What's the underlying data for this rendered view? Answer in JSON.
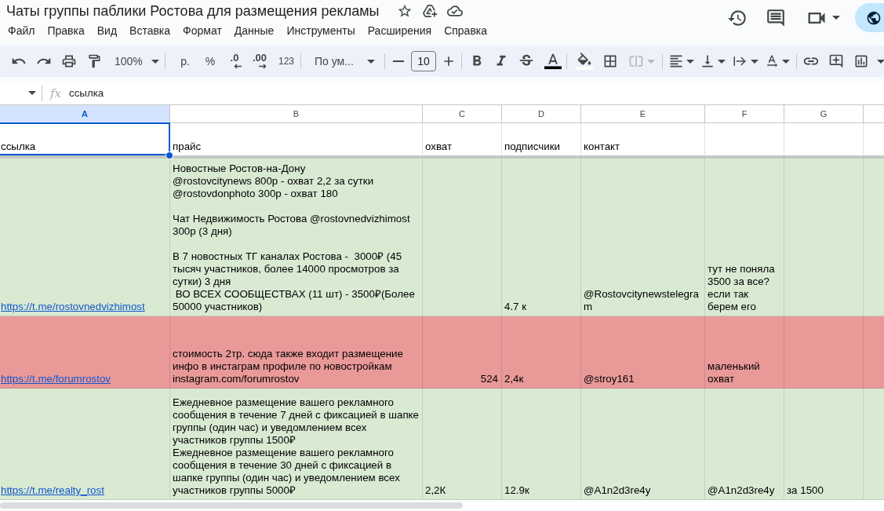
{
  "document": {
    "title": "Чаты группы паблики Ростова для размещения рекламы"
  },
  "menu": [
    "Файл",
    "Правка",
    "Вид",
    "Вставка",
    "Формат",
    "Данные",
    "Инструменты",
    "Расширения",
    "Справка"
  ],
  "toolbar": {
    "zoom": "100%",
    "currency": "р.",
    "percent": "%",
    "decimal_decrease": ".0",
    "decimal_increase": ".00",
    "number_format": "123",
    "font": "По ум...",
    "font_size": "10",
    "merge": {
      "disabled": true
    }
  },
  "formula_bar": {
    "function_label": "fx",
    "formula": "ссылка"
  },
  "columns": [
    {
      "letter": "A",
      "selected": true
    },
    {
      "letter": "B",
      "selected": false
    },
    {
      "letter": "C",
      "selected": false
    },
    {
      "letter": "D",
      "selected": false
    },
    {
      "letter": "E",
      "selected": false
    },
    {
      "letter": "F",
      "selected": false
    },
    {
      "letter": "G",
      "selected": false
    },
    {
      "selected": false
    }
  ],
  "rows": [
    {
      "selected": true,
      "cells": [
        {
          "text": "ссылка",
          "kind": "text"
        },
        {
          "text": "прайс",
          "kind": "text"
        },
        {
          "text": "охват",
          "kind": "text"
        },
        {
          "text": "подписчики",
          "kind": "text"
        },
        {
          "text": "контакт",
          "kind": "text"
        }
      ]
    },
    {
      "selected": false,
      "color": "#d9ead3",
      "cells": [
        {
          "text": "https://t.me/rostovnedvizhimost",
          "kind": "link"
        },
        {
          "text": "Новостные Ростов-на-Дону\n@rostovcitynews 800р - охват 2,2 за сутки\n@rostovdonphoto 300р - охват 180\n\nЧат Недвижимость Ростова @rostovnedvizhimost\n300р (3 дня)\n\nВ 7 новостных ТГ каналах Ростова -  3000₽ (45\nтысяч участников, более 14000 просмотров за\nсутки) 3 дня\n ВО ВСЕХ СООБЩЕСТВАХ (11 шт) - 3500₽(Более\n50000 участников)",
          "kind": "text"
        },
        null,
        {
          "text": "4.7 к",
          "kind": "text"
        },
        {
          "text": "@Rostovcitynewstelegram",
          "kind": "text"
        },
        {
          "text": "тут не поняла\n3500 за все?\nесли так\nберем его",
          "kind": "text"
        }
      ]
    },
    {
      "selected": false,
      "color": "#ea9999",
      "cells": [
        {
          "text": "https://t.me/forumrostov",
          "kind": "link"
        },
        {
          "text": "стоимость 2тр. сюда также входит размещение\nинфо в инстаграм профиле по новостройкам\ninstagram.com/forumrostov",
          "kind": "text"
        },
        {
          "text": "524",
          "kind": "number"
        },
        {
          "text": "2,4к",
          "kind": "text"
        },
        {
          "text": "@stroy161",
          "kind": "text"
        },
        {
          "text": "маленький\nохват",
          "kind": "text"
        }
      ]
    },
    {
      "selected": false,
      "color": "#d9ead3",
      "cells": [
        {
          "text": "https://t.me/realty_rost",
          "kind": "link"
        },
        {
          "text": "Ежедневное размещение вашего рекламного\nсообщения в течение 7 дней с фиксацией в шапке\nгруппы (один час) и уведомлением всех\nучастников группы 1500₽\nЕжедневное размещение вашего рекламного\nсообщения в течение 30 дней с фиксацией в\nшапке группы (один час) и уведомлением всех\nучастников группы 5000₽",
          "kind": "text"
        },
        {
          "text": "2,2К",
          "kind": "text"
        },
        {
          "text": "12.9к",
          "kind": "text"
        },
        {
          "text": "@A1n2d3re4y",
          "kind": "text"
        },
        {
          "text": "@A1n2d3re4y",
          "kind": "text"
        },
        {
          "text": "за 1500",
          "kind": "text"
        }
      ]
    }
  ]
}
